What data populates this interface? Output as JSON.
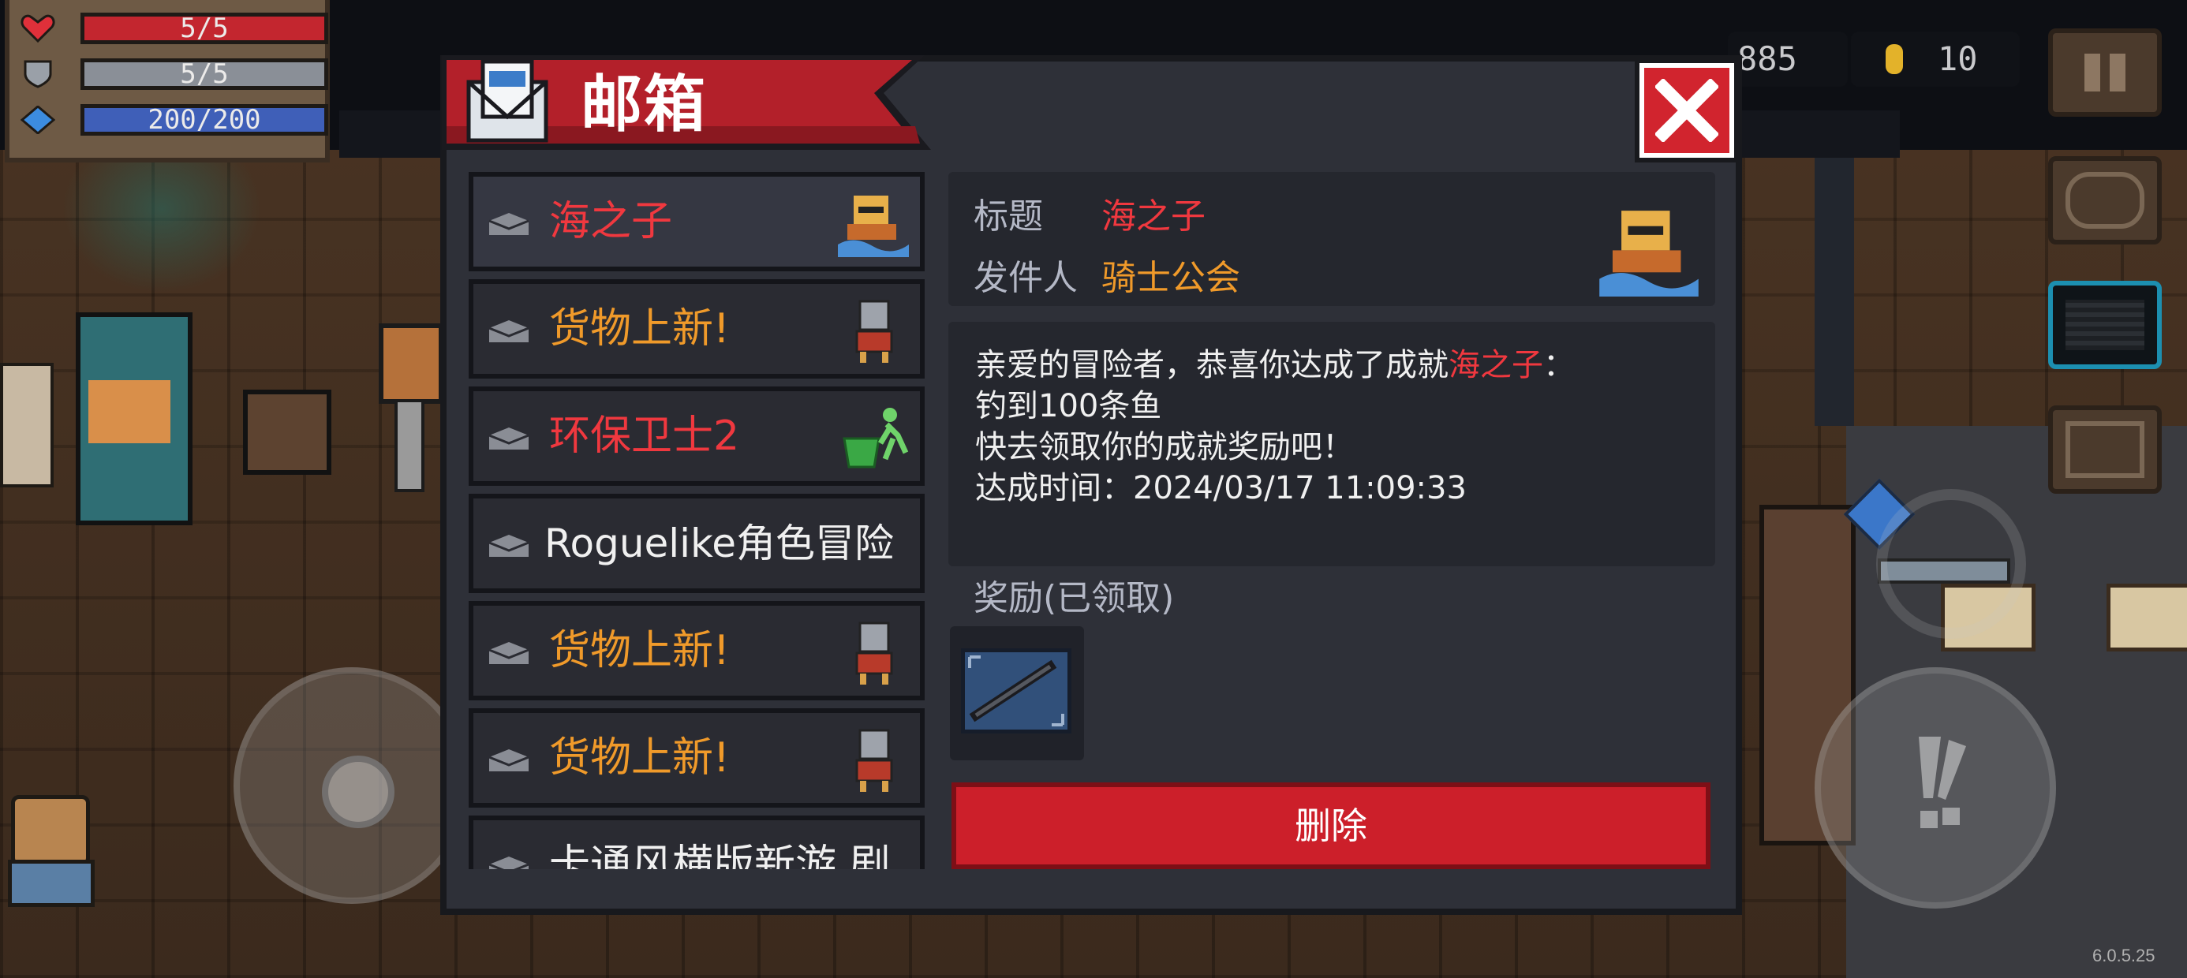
{
  "hud": {
    "health": "5/5",
    "armor": "5/5",
    "energy": "200/200",
    "gems": "885",
    "coins": "10",
    "version": "6.0.5.25"
  },
  "colors": {
    "accent_red": "#d1242e",
    "title_red": "#f0383f",
    "title_orange": "#f09a2a",
    "label_gray": "#b4b8c6"
  },
  "dialog": {
    "title": "邮箱",
    "close_icon": "close-x-icon"
  },
  "mail_list": [
    {
      "title": "海之子",
      "color": "#f0383f",
      "icon": "fisher-avatar-icon",
      "selected": true
    },
    {
      "title": "货物上新!",
      "color": "#f09a2a",
      "icon": "merchant-cat-icon",
      "selected": false
    },
    {
      "title": "环保卫士2",
      "color": "#f0383f",
      "icon": "recycle-bin-icon",
      "selected": false
    },
    {
      "title": "Roguelike角色冒险",
      "color": "#f0f0f0",
      "icon": "",
      "selected": false
    },
    {
      "title": "货物上新!",
      "color": "#f09a2a",
      "icon": "merchant-cat-icon",
      "selected": false
    },
    {
      "title": "货物上新!",
      "color": "#f09a2a",
      "icon": "merchant-cat-icon",
      "selected": false
    },
    {
      "title": "卡通风横版新游 剧",
      "color": "#f0f0f0",
      "icon": "",
      "selected": false
    }
  ],
  "detail": {
    "title_label": "标题",
    "title_value": "海之子",
    "sender_label": "发件人",
    "sender_value": "骑士公会",
    "body_line1_prefix": "亲爱的冒险者，恭喜你达成了成就",
    "body_line1_highlight": "海之子",
    "body_line1_suffix": "：",
    "body_line2": "钓到100条鱼",
    "body_line3": "快去领取你的成就奖励吧！",
    "body_line4": "达成时间：2024/03/17 11:09:33",
    "reward_label": "奖励(已领取)",
    "reward_item_icon": "rifle-weapon-icon",
    "delete_label": "删除"
  }
}
